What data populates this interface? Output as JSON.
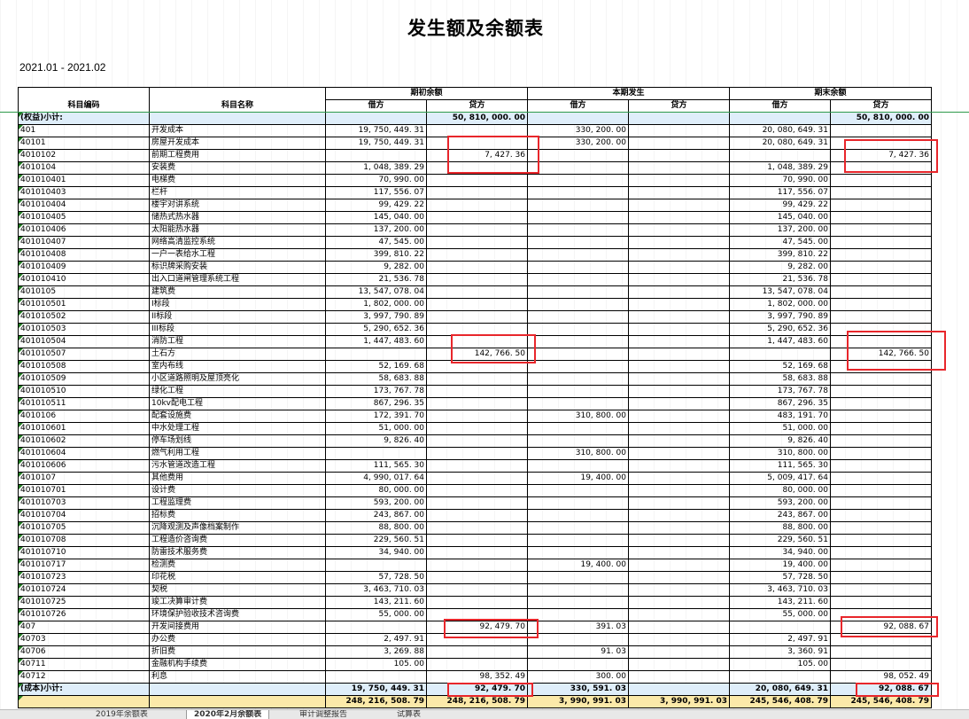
{
  "title": "发生额及余额表",
  "period": "2021.01 - 2021.02",
  "headers": {
    "code": "科目编码",
    "name": "科目名称",
    "opening": "期初余额",
    "current": "本期发生",
    "closing": "期末余额",
    "debit": "借方",
    "credit": "贷方"
  },
  "rows": [
    {
      "t": "sub",
      "code": "(权益)小计:",
      "name": "",
      "v": [
        "",
        "50, 810, 000. 00",
        "",
        "",
        "",
        "50, 810, 000. 00"
      ]
    },
    {
      "l": 0,
      "code": "401",
      "name": "开发成本",
      "v": [
        "19, 750, 449. 31",
        "",
        "330, 200. 00",
        "",
        "20, 080, 649. 31",
        ""
      ]
    },
    {
      "l": 1,
      "code": "40101",
      "name": "房屋开发成本",
      "v": [
        "19, 750, 449. 31",
        "",
        "330, 200. 00",
        "",
        "20, 080, 649. 31",
        ""
      ]
    },
    {
      "l": 2,
      "code": "4010102",
      "name": "前期工程费用",
      "v": [
        "",
        "7, 427. 36",
        "",
        "",
        "",
        "7, 427. 36"
      ]
    },
    {
      "l": 2,
      "code": "4010104",
      "name": "安装费",
      "v": [
        "1, 048, 389. 29",
        "",
        "",
        "",
        "1, 048, 389. 29",
        ""
      ]
    },
    {
      "l": 3,
      "code": "401010401",
      "name": "电梯费",
      "v": [
        "70, 990. 00",
        "",
        "",
        "",
        "70, 990. 00",
        ""
      ]
    },
    {
      "l": 3,
      "code": "401010403",
      "name": "栏杆",
      "v": [
        "117, 556. 07",
        "",
        "",
        "",
        "117, 556. 07",
        ""
      ]
    },
    {
      "l": 3,
      "code": "401010404",
      "name": "楼宇对讲系统",
      "v": [
        "99, 429. 22",
        "",
        "",
        "",
        "99, 429. 22",
        ""
      ]
    },
    {
      "l": 3,
      "code": "401010405",
      "name": "储热式热水器",
      "v": [
        "145, 040. 00",
        "",
        "",
        "",
        "145, 040. 00",
        ""
      ]
    },
    {
      "l": 3,
      "code": "401010406",
      "name": "太阳能热水器",
      "v": [
        "137, 200. 00",
        "",
        "",
        "",
        "137, 200. 00",
        ""
      ]
    },
    {
      "l": 3,
      "code": "401010407",
      "name": "网络高清监控系统",
      "v": [
        "47, 545. 00",
        "",
        "",
        "",
        "47, 545. 00",
        ""
      ]
    },
    {
      "l": 3,
      "code": "401010408",
      "name": "一户一表给水工程",
      "v": [
        "399, 810. 22",
        "",
        "",
        "",
        "399, 810. 22",
        ""
      ]
    },
    {
      "l": 3,
      "code": "401010409",
      "name": "标识牌采购安装",
      "v": [
        "9, 282. 00",
        "",
        "",
        "",
        "9, 282. 00",
        ""
      ]
    },
    {
      "l": 3,
      "code": "401010410",
      "name": "出入口道闸管理系统工程",
      "v": [
        "21, 536. 78",
        "",
        "",
        "",
        "21, 536. 78",
        ""
      ]
    },
    {
      "l": 2,
      "code": "4010105",
      "name": "建筑费",
      "v": [
        "13, 547, 078. 04",
        "",
        "",
        "",
        "13, 547, 078. 04",
        ""
      ]
    },
    {
      "l": 3,
      "code": "401010501",
      "name": "I标段",
      "v": [
        "1, 802, 000. 00",
        "",
        "",
        "",
        "1, 802, 000. 00",
        ""
      ]
    },
    {
      "l": 3,
      "code": "401010502",
      "name": "II标段",
      "v": [
        "3, 997, 790. 89",
        "",
        "",
        "",
        "3, 997, 790. 89",
        ""
      ]
    },
    {
      "l": 3,
      "code": "401010503",
      "name": "III标段",
      "v": [
        "5, 290, 652. 36",
        "",
        "",
        "",
        "5, 290, 652. 36",
        ""
      ]
    },
    {
      "l": 3,
      "code": "401010504",
      "name": "消防工程",
      "v": [
        "1, 447, 483. 60",
        "",
        "",
        "",
        "1, 447, 483. 60",
        ""
      ]
    },
    {
      "l": 3,
      "code": "401010507",
      "name": "土石方",
      "v": [
        "",
        "142, 766. 50",
        "",
        "",
        "",
        "142, 766. 50"
      ]
    },
    {
      "l": 3,
      "code": "401010508",
      "name": "室内布线",
      "v": [
        "52, 169. 68",
        "",
        "",
        "",
        "52, 169. 68",
        ""
      ]
    },
    {
      "l": 3,
      "code": "401010509",
      "name": "小区道路照明及屋顶亮化",
      "v": [
        "58, 683. 88",
        "",
        "",
        "",
        "58, 683. 88",
        ""
      ]
    },
    {
      "l": 3,
      "code": "401010510",
      "name": "绿化工程",
      "v": [
        "173, 767. 78",
        "",
        "",
        "",
        "173, 767. 78",
        ""
      ]
    },
    {
      "l": 3,
      "code": "401010511",
      "name": "10kv配电工程",
      "v": [
        "867, 296. 35",
        "",
        "",
        "",
        "867, 296. 35",
        ""
      ]
    },
    {
      "l": 2,
      "code": "4010106",
      "name": "配套设施费",
      "v": [
        "172, 391. 70",
        "",
        "310, 800. 00",
        "",
        "483, 191. 70",
        ""
      ]
    },
    {
      "l": 3,
      "code": "401010601",
      "name": "中水处理工程",
      "v": [
        "51, 000. 00",
        "",
        "",
        "",
        "51, 000. 00",
        ""
      ]
    },
    {
      "l": 3,
      "code": "401010602",
      "name": "停车场划线",
      "v": [
        "9, 826. 40",
        "",
        "",
        "",
        "9, 826. 40",
        ""
      ]
    },
    {
      "l": 3,
      "code": "401010604",
      "name": "燃气利用工程",
      "v": [
        "",
        "",
        "310, 800. 00",
        "",
        "310, 800. 00",
        ""
      ]
    },
    {
      "l": 3,
      "code": "401010606",
      "name": "污水管道改造工程",
      "v": [
        "111, 565. 30",
        "",
        "",
        "",
        "111, 565. 30",
        ""
      ]
    },
    {
      "l": 2,
      "code": "4010107",
      "name": "其他费用",
      "v": [
        "4, 990, 017. 64",
        "",
        "19, 400. 00",
        "",
        "5, 009, 417. 64",
        ""
      ]
    },
    {
      "l": 3,
      "code": "401010701",
      "name": "设计费",
      "v": [
        "80, 000. 00",
        "",
        "",
        "",
        "80, 000. 00",
        ""
      ]
    },
    {
      "l": 3,
      "code": "401010703",
      "name": "工程监理费",
      "v": [
        "593, 200. 00",
        "",
        "",
        "",
        "593, 200. 00",
        ""
      ]
    },
    {
      "l": 3,
      "code": "401010704",
      "name": "招标费",
      "v": [
        "243, 867. 00",
        "",
        "",
        "",
        "243, 867. 00",
        ""
      ]
    },
    {
      "l": 3,
      "code": "401010705",
      "name": "沉降观测及声像档案制作",
      "v": [
        "88, 800. 00",
        "",
        "",
        "",
        "88, 800. 00",
        ""
      ]
    },
    {
      "l": 3,
      "code": "401010708",
      "name": "工程造价咨询费",
      "v": [
        "229, 560. 51",
        "",
        "",
        "",
        "229, 560. 51",
        ""
      ]
    },
    {
      "l": 3,
      "code": "401010710",
      "name": "防雷技术服务费",
      "v": [
        "34, 940. 00",
        "",
        "",
        "",
        "34, 940. 00",
        ""
      ]
    },
    {
      "l": 3,
      "code": "401010717",
      "name": "检测费",
      "v": [
        "",
        "",
        "19, 400. 00",
        "",
        "19, 400. 00",
        ""
      ]
    },
    {
      "l": 3,
      "code": "401010723",
      "name": "印花税",
      "v": [
        "57, 728. 50",
        "",
        "",
        "",
        "57, 728. 50",
        ""
      ]
    },
    {
      "l": 3,
      "code": "401010724",
      "name": "契税",
      "v": [
        "3, 463, 710. 03",
        "",
        "",
        "",
        "3, 463, 710. 03",
        ""
      ]
    },
    {
      "l": 3,
      "code": "401010725",
      "name": "竣工决算审计费",
      "v": [
        "143, 211. 60",
        "",
        "",
        "",
        "143, 211. 60",
        ""
      ]
    },
    {
      "l": 3,
      "code": "401010726",
      "name": "环境保护验收技术咨询费",
      "v": [
        "55, 000. 00",
        "",
        "",
        "",
        "55, 000. 00",
        ""
      ]
    },
    {
      "l": 0,
      "code": "407",
      "name": "开发间接费用",
      "v": [
        "",
        "92, 479. 70",
        "391. 03",
        "",
        "",
        "92, 088. 67"
      ]
    },
    {
      "l": 1,
      "code": "40703",
      "name": "办公费",
      "v": [
        "2, 497. 91",
        "",
        "",
        "",
        "2, 497. 91",
        ""
      ]
    },
    {
      "l": 1,
      "code": "40706",
      "name": "折旧费",
      "v": [
        "3, 269. 88",
        "",
        "91. 03",
        "",
        "3, 360. 91",
        ""
      ]
    },
    {
      "l": 1,
      "code": "40711",
      "name": "金融机构手续费",
      "v": [
        "105. 00",
        "",
        "",
        "",
        "105. 00",
        ""
      ]
    },
    {
      "l": 1,
      "code": "40712",
      "name": "利息",
      "v": [
        "",
        "98, 352. 49",
        "300. 00",
        "",
        "",
        "98, 052. 49"
      ]
    },
    {
      "t": "sub",
      "code": "(成本)小计:",
      "name": "",
      "v": [
        "19, 750, 449. 31",
        "92, 479. 70",
        "330, 591. 03",
        "",
        "20, 080, 649. 31",
        "92, 088. 67"
      ]
    },
    {
      "t": "total",
      "code": "",
      "name": "",
      "v": [
        "248, 216, 508. 79",
        "248, 216, 508. 79",
        "3, 990, 991. 03",
        "3, 990, 991. 03",
        "245, 546, 408. 79",
        "245, 546, 408. 79"
      ]
    }
  ],
  "sheet_tabs": [
    "2019年余额表",
    "2020年2月余额表",
    "审计调整报告",
    "试算表"
  ]
}
